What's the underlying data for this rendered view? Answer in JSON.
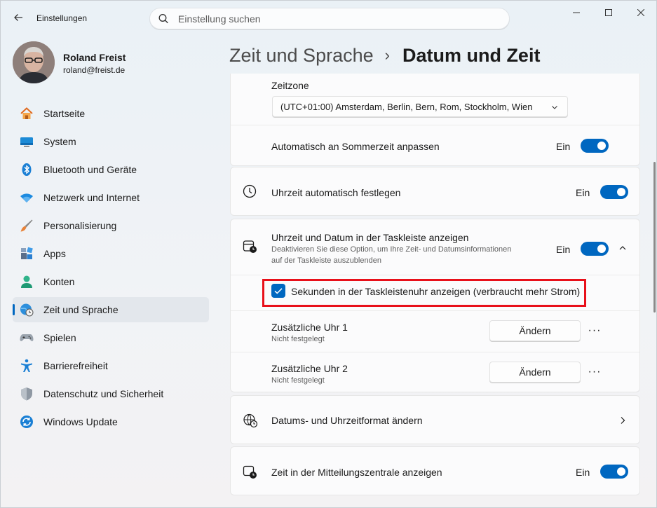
{
  "window": {
    "app_title": "Einstellungen",
    "back_icon": "arrow-left-icon",
    "search": {
      "placeholder": "Einstellung suchen"
    }
  },
  "profile": {
    "name": "Roland Freist",
    "email": "roland@freist.de"
  },
  "sidebar": {
    "items": [
      {
        "label": "Startseite",
        "icon": "home-icon"
      },
      {
        "label": "System",
        "icon": "monitor-icon"
      },
      {
        "label": "Bluetooth und Geräte",
        "icon": "bluetooth-icon"
      },
      {
        "label": "Netzwerk und Internet",
        "icon": "wifi-icon"
      },
      {
        "label": "Personalisierung",
        "icon": "brush-icon"
      },
      {
        "label": "Apps",
        "icon": "apps-icon"
      },
      {
        "label": "Konten",
        "icon": "person-icon"
      },
      {
        "label": "Zeit und Sprache",
        "icon": "globe-clock-icon",
        "active": true
      },
      {
        "label": "Spielen",
        "icon": "gamepad-icon"
      },
      {
        "label": "Barrierefreiheit",
        "icon": "accessibility-icon"
      },
      {
        "label": "Datenschutz und Sicherheit",
        "icon": "shield-icon"
      },
      {
        "label": "Windows Update",
        "icon": "update-icon"
      }
    ]
  },
  "header": {
    "parent": "Zeit und Sprache",
    "separator": "›",
    "current": "Datum und Zeit"
  },
  "settings": {
    "timezone": {
      "label": "Zeitzone",
      "value": "(UTC+01:00) Amsterdam, Berlin, Bern, Rom, Stockholm, Wien"
    },
    "dst": {
      "label": "Automatisch an Sommerzeit anpassen",
      "state": "Ein"
    },
    "auto_time": {
      "label": "Uhrzeit automatisch festlegen",
      "state": "Ein"
    },
    "taskbar": {
      "label": "Uhrzeit und Datum in der Taskleiste anzeigen",
      "desc_line1": "Deaktivieren Sie diese Option, um Ihre Zeit- und Datumsinformationen",
      "desc_line2": "auf der Taskleiste auszublenden",
      "state": "Ein",
      "seconds_label": "Sekunden in der Taskleistenuhr anzeigen (verbraucht mehr Strom)"
    },
    "clock1": {
      "label": "Zusätzliche Uhr 1",
      "sub": "Nicht festgelegt",
      "button": "Ändern",
      "more": "···"
    },
    "clock2": {
      "label": "Zusätzliche Uhr 2",
      "sub": "Nicht festgelegt",
      "button": "Ändern",
      "more": "···"
    },
    "format": {
      "label": "Datums- und Uhrzeitformat ändern"
    },
    "notification": {
      "label": "Zeit in der Mitteilungszentrale anzeigen",
      "state": "Ein"
    }
  },
  "colors": {
    "accent": "#0067c0",
    "highlight_border": "#e8101a"
  }
}
